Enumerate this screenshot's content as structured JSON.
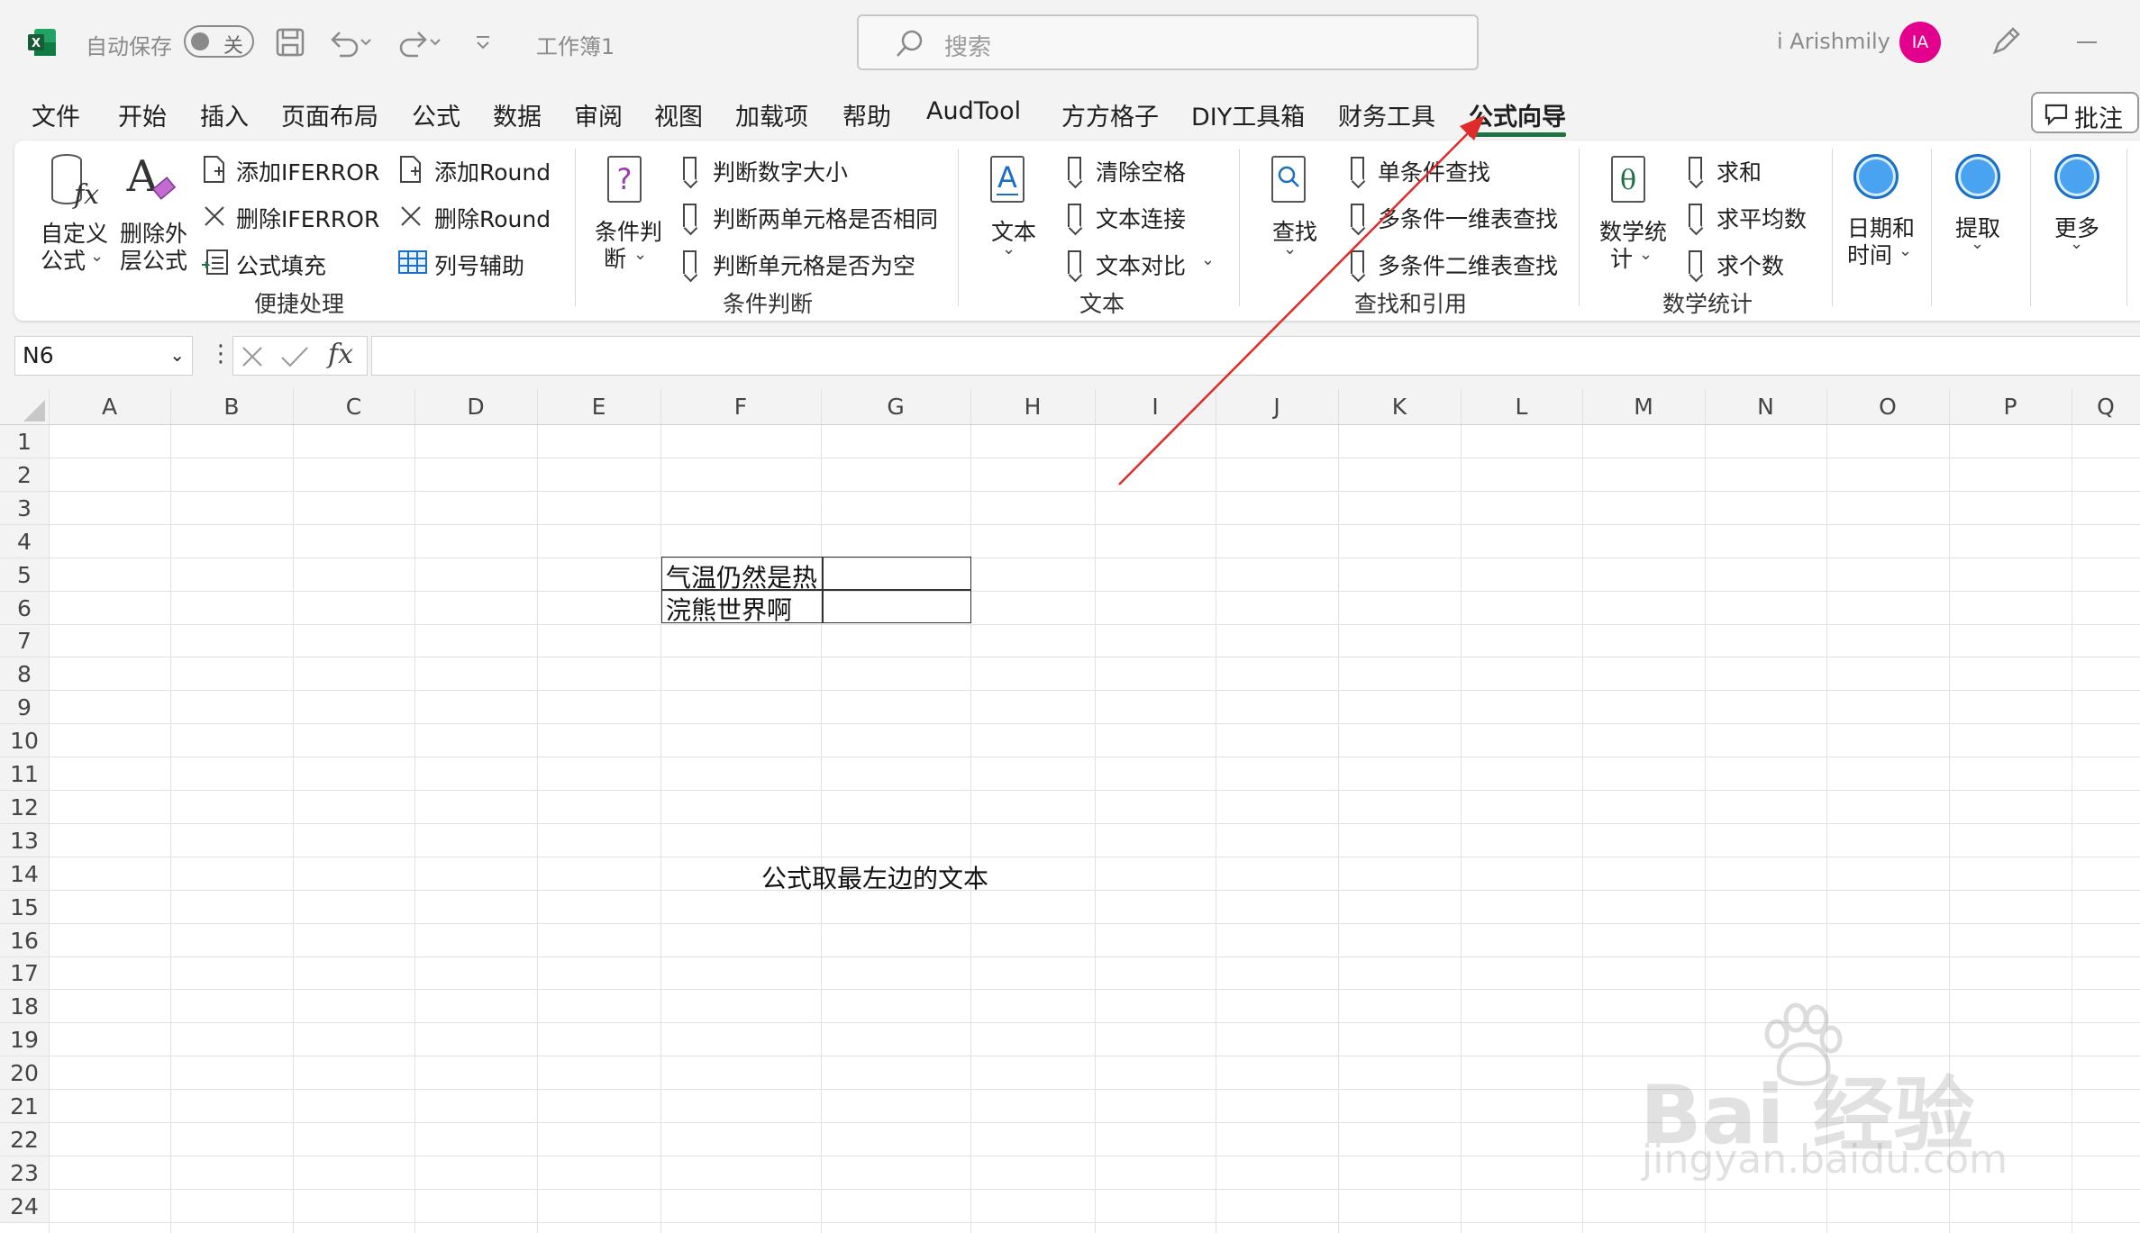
{
  "titlebar": {
    "autosave_label": "自动保存",
    "autosave_state": "关",
    "file_name": "工作簿1",
    "search_placeholder": "搜索",
    "user_name": "i Arishmily",
    "avatar_initials": "IA"
  },
  "tabs": [
    {
      "label": "文件"
    },
    {
      "label": "开始"
    },
    {
      "label": "插入"
    },
    {
      "label": "页面布局"
    },
    {
      "label": "公式"
    },
    {
      "label": "数据"
    },
    {
      "label": "审阅"
    },
    {
      "label": "视图"
    },
    {
      "label": "加载项"
    },
    {
      "label": "帮助"
    },
    {
      "label": "AudTool"
    },
    {
      "label": "方方格子"
    },
    {
      "label": "DIY工具箱"
    },
    {
      "label": "财务工具"
    },
    {
      "label": "公式向导",
      "active": true
    }
  ],
  "comments_button": "批注",
  "ribbon": {
    "quick": {
      "custom_formula_l1": "自定义",
      "custom_formula_l2": "公式",
      "delete_outer_l1": "删除外",
      "delete_outer_l2": "层公式",
      "add_iferror": "添加IFERROR",
      "del_iferror": "删除IFERROR",
      "formula_fill": "公式填充",
      "add_round": "添加Round",
      "del_round": "删除Round",
      "col_helper": "列号辅助",
      "group_label": "便捷处理"
    },
    "cond": {
      "big_l1": "条件判",
      "big_l2": "断",
      "item1": "判断数字大小",
      "item2": "判断两单元格是否相同",
      "item3": "判断单元格是否为空",
      "group_label": "条件判断"
    },
    "text": {
      "big": "文本",
      "item1": "清除空格",
      "item2": "文本连接",
      "item3": "文本对比",
      "group_label": "文本"
    },
    "lookup": {
      "big": "查找",
      "item1": "单条件查找",
      "item2": "多条件一维表查找",
      "item3": "多条件二维表查找",
      "group_label": "查找和引用"
    },
    "math": {
      "big_l1": "数学统",
      "big_l2": "计",
      "item1": "求和",
      "item2": "求平均数",
      "item3": "求个数",
      "group_label": "数学统计"
    },
    "date_l1": "日期和",
    "date_l2": "时间",
    "extract": "提取",
    "more": "更多"
  },
  "formula_bar": {
    "name_box": "N6",
    "formula": ""
  },
  "columns": [
    "A",
    "B",
    "C",
    "D",
    "E",
    "F",
    "G",
    "H",
    "I",
    "J",
    "K",
    "L",
    "M",
    "N",
    "O",
    "P",
    "Q"
  ],
  "rows": [
    "1",
    "2",
    "3",
    "4",
    "5",
    "6",
    "7",
    "8",
    "9",
    "10",
    "11",
    "12",
    "13",
    "14",
    "15",
    "16",
    "17",
    "18",
    "19",
    "20",
    "21",
    "22",
    "23",
    "24"
  ],
  "cells": {
    "F5": "气温仍然是热",
    "F6": "浣熊世界啊",
    "F14": "公式取最左边的文本"
  },
  "watermark": {
    "line1": "Bai 经验",
    "line2": "jingyan.baidu.com"
  },
  "colors": {
    "excel_green": "#1e7145",
    "avatar": "#e3008c",
    "arrow": "#e02b2b"
  }
}
